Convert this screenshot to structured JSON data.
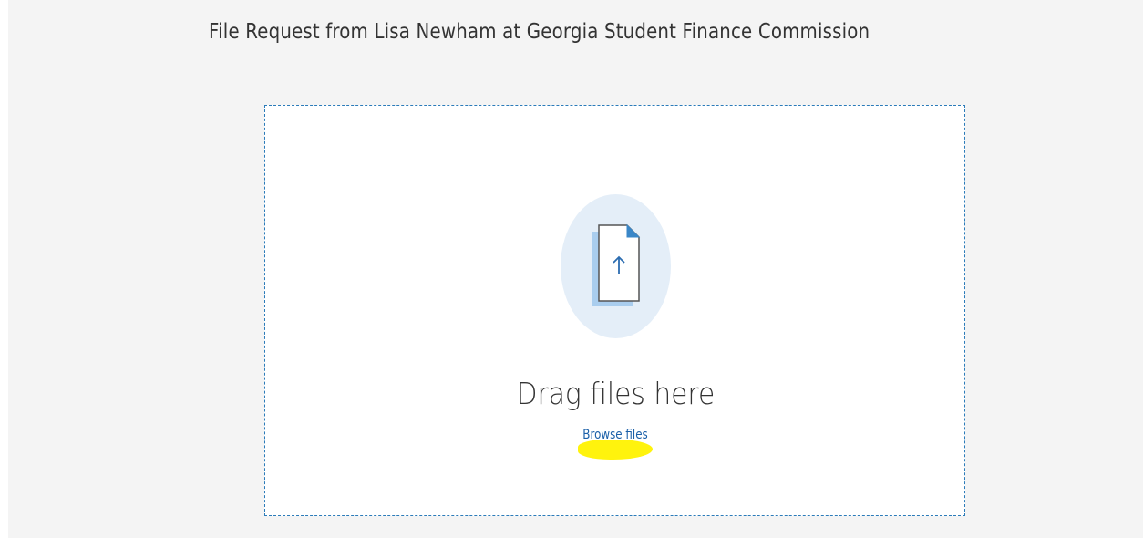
{
  "header": {
    "title": "File Request from Lisa Newham at Georgia Student Finance Commission"
  },
  "dropzone": {
    "prompt": "Drag files here",
    "browse_label": "Browse files",
    "icon": "file-upload-icon"
  },
  "colors": {
    "background": "#f4f4f4",
    "dropzone_border": "#2b7bb9",
    "icon_circle": "#e4eef8",
    "link": "#1a5fa8",
    "annotation_highlight": "#fff200"
  }
}
